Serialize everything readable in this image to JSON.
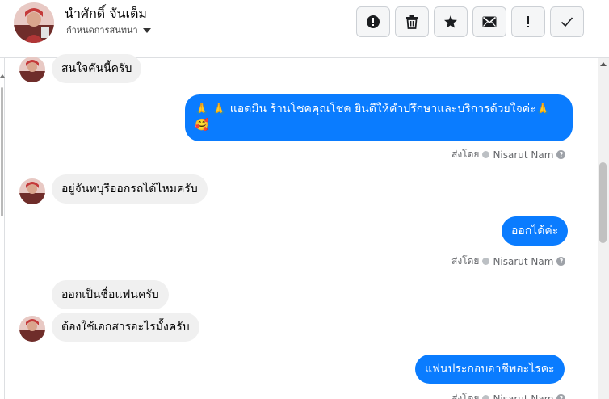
{
  "header": {
    "contact_name": "นำศักดิ์ จันเต็ม",
    "assign_label": "กำหนดการสนทนา",
    "toolbar": [
      {
        "name": "report-spam-button",
        "icon": "exclamation-circle-icon"
      },
      {
        "name": "delete-button",
        "icon": "trash-icon"
      },
      {
        "name": "star-button",
        "icon": "star-icon"
      },
      {
        "name": "mark-unread-button",
        "icon": "envelope-icon"
      },
      {
        "name": "follow-up-button",
        "icon": "exclamation-icon"
      },
      {
        "name": "mark-done-button",
        "icon": "check-icon"
      }
    ]
  },
  "messages": {
    "m1": "สนใจคันนี้ครับ",
    "m2_line1": "🙏 🙏 แอดมิน ร้านโชคคุณโชค ยินดีให้คำปรึกษาและบริการด้วยใจค่ะ🙏",
    "m2_line2": "🥰",
    "m3": "อยู่จันทบุรีออกรถได้ไหมครับ",
    "m4": "ออกได้ค่ะ",
    "m5": "ออกเป็นชื่อแฟนครับ",
    "m6": "ต้องใช้เอกสารอะไรมั้งครับ",
    "m7": "แฟนประกอบอาชีพอะไรคะ"
  },
  "sent_by": {
    "prefix": "ส่งโดย",
    "agent": "Nisarut Nam",
    "help": "?"
  },
  "colors": {
    "outgoing_bubble": "#0a7cff",
    "incoming_bubble": "#f0f0f0",
    "meta_text": "#65676b"
  }
}
